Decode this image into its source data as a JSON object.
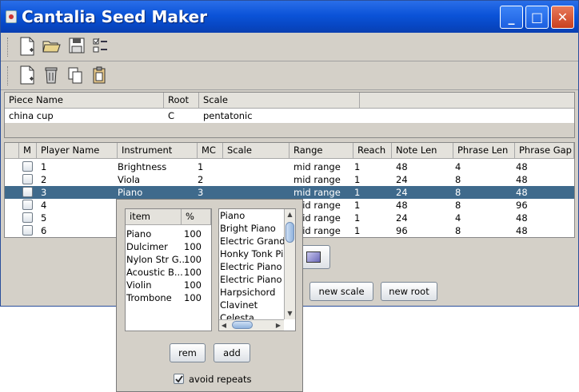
{
  "window": {
    "title": "Cantalia Seed Maker",
    "controls": {
      "minimize": "_",
      "maximize": "□",
      "close": "✕"
    }
  },
  "toolbar1": {
    "icons": [
      "new-file-icon",
      "open-folder-icon",
      "save-icon",
      "checklist-icon"
    ]
  },
  "toolbar2": {
    "icons": [
      "new-file-icon",
      "trash-icon",
      "copy-icon",
      "paste-icon"
    ]
  },
  "piece_table": {
    "headers": [
      "Piece Name",
      "Root",
      "Scale"
    ],
    "row": {
      "name": "china cup",
      "root": "C",
      "scale": "pentatonic"
    }
  },
  "players_table": {
    "headers": [
      "M",
      "Player Name",
      "Instrument",
      "MC",
      "Scale",
      "Range",
      "Reach",
      "Note Len",
      "Phrase Len",
      "Phrase Gap"
    ],
    "rows": [
      {
        "player": "1",
        "instrument": "Brightness",
        "mc": "1",
        "scale": "",
        "range": "mid range",
        "reach": "1",
        "note_len": "48",
        "phrase_len": "4",
        "phrase_gap": "48"
      },
      {
        "player": "2",
        "instrument": "Viola",
        "mc": "2",
        "scale": "",
        "range": "mid range",
        "reach": "1",
        "note_len": "24",
        "phrase_len": "8",
        "phrase_gap": "48"
      },
      {
        "player": "3",
        "instrument": "Piano",
        "mc": "3",
        "scale": "",
        "range": "mid range",
        "reach": "1",
        "note_len": "24",
        "phrase_len": "8",
        "phrase_gap": "48"
      },
      {
        "player": "4",
        "instrument": "",
        "mc": "",
        "scale": "",
        "range": "mid range",
        "reach": "1",
        "note_len": "48",
        "phrase_len": "8",
        "phrase_gap": "96"
      },
      {
        "player": "5",
        "instrument": "",
        "mc": "",
        "scale": "",
        "range": "mid range",
        "reach": "1",
        "note_len": "24",
        "phrase_len": "4",
        "phrase_gap": "48"
      },
      {
        "player": "6",
        "instrument": "",
        "mc": "",
        "scale": "",
        "range": "mid range",
        "reach": "1",
        "note_len": "96",
        "phrase_len": "8",
        "phrase_gap": "48"
      }
    ]
  },
  "buttons": {
    "new_scale": "new scale",
    "new_root": "new root"
  },
  "popup": {
    "table_headers": [
      "item",
      "%"
    ],
    "items": [
      {
        "name": "Piano",
        "pct": "100"
      },
      {
        "name": "Dulcimer",
        "pct": "100"
      },
      {
        "name": "Nylon Str G...",
        "pct": "100"
      },
      {
        "name": "Acoustic B...",
        "pct": "100"
      },
      {
        "name": "Violin",
        "pct": "100"
      },
      {
        "name": "Trombone",
        "pct": "100"
      }
    ],
    "instrument_list": [
      "Piano",
      "Bright Piano",
      "Electric Grand",
      "Honky Tonk Pi",
      "Electric Piano",
      "Electric Piano",
      "Harpsichord",
      "Clavinet",
      "Celesta"
    ],
    "rem_label": "rem",
    "add_label": "add",
    "avoid_repeats_label": "avoid repeats",
    "avoid_repeats_checked": true
  }
}
